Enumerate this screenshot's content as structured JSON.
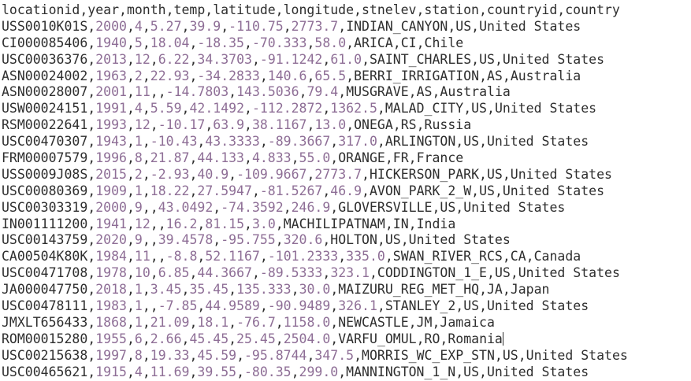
{
  "header": "locationid,year,month,temp,latitude,longitude,stnelev,station,countryid,country",
  "colors": {
    "text": "#2e2e2e",
    "number": "#8e6e96",
    "background": "#ffffff"
  },
  "rows": [
    [
      "USS0010K01S",
      "2000",
      "4",
      "5.27",
      "39.9",
      "-110.75",
      "2773.7",
      "INDIAN_CANYON",
      "US",
      "United States"
    ],
    [
      "CI000085406",
      "1940",
      "5",
      "18.04",
      "-18.35",
      "-70.333",
      "58.0",
      "ARICA",
      "CI",
      "Chile"
    ],
    [
      "USC00036376",
      "2013",
      "12",
      "6.22",
      "34.3703",
      "-91.1242",
      "61.0",
      "SAINT_CHARLES",
      "US",
      "United States"
    ],
    [
      "ASN00024002",
      "1963",
      "2",
      "22.93",
      "-34.2833",
      "140.6",
      "65.5",
      "BERRI_IRRIGATION",
      "AS",
      "Australia"
    ],
    [
      "ASN00028007",
      "2001",
      "11",
      "",
      "-14.7803",
      "143.5036",
      "79.4",
      "MUSGRAVE",
      "AS",
      "Australia"
    ],
    [
      "USW00024151",
      "1991",
      "4",
      "5.59",
      "42.1492",
      "-112.2872",
      "1362.5",
      "MALAD_CITY",
      "US",
      "United States"
    ],
    [
      "RSM00022641",
      "1993",
      "12",
      "-10.17",
      "63.9",
      "38.1167",
      "13.0",
      "ONEGA",
      "RS",
      "Russia"
    ],
    [
      "USC00470307",
      "1943",
      "1",
      "-10.43",
      "43.3333",
      "-89.3667",
      "317.0",
      "ARLINGTON",
      "US",
      "United States"
    ],
    [
      "FRM00007579",
      "1996",
      "8",
      "21.87",
      "44.133",
      "4.833",
      "55.0",
      "ORANGE",
      "FR",
      "France"
    ],
    [
      "USS0009J08S",
      "2015",
      "2",
      "-2.93",
      "40.9",
      "-109.9667",
      "2773.7",
      "HICKERSON_PARK",
      "US",
      "United States"
    ],
    [
      "USC00080369",
      "1909",
      "1",
      "18.22",
      "27.5947",
      "-81.5267",
      "46.9",
      "AVON_PARK_2_W",
      "US",
      "United States"
    ],
    [
      "USC00303319",
      "2000",
      "9",
      "",
      "43.0492",
      "-74.3592",
      "246.9",
      "GLOVERSVILLE",
      "US",
      "United States"
    ],
    [
      "IN001111200",
      "1941",
      "12",
      "",
      "16.2",
      "81.15",
      "3.0",
      "MACHILIPATNAM",
      "IN",
      "India"
    ],
    [
      "USC00143759",
      "2020",
      "9",
      "",
      "39.4578",
      "-95.755",
      "320.6",
      "HOLTON",
      "US",
      "United States"
    ],
    [
      "CA00504K80K",
      "1984",
      "11",
      "",
      "-8.8",
      "52.1167",
      "-101.2333",
      "335.0",
      "SWAN_RIVER_RCS",
      "CA",
      "Canada"
    ],
    [
      "USC00471708",
      "1978",
      "10",
      "6.85",
      "44.3667",
      "-89.5333",
      "323.1",
      "CODDINGTON_1_E",
      "US",
      "United States"
    ],
    [
      "JA000047750",
      "2018",
      "1",
      "3.45",
      "35.45",
      "135.333",
      "30.0",
      "MAIZURU_REG_MET_HQ",
      "JA",
      "Japan"
    ],
    [
      "USC00478111",
      "1983",
      "1",
      "",
      "-7.85",
      "44.9589",
      "-90.9489",
      "326.1",
      "STANLEY_2",
      "US",
      "United States"
    ],
    [
      "JMXLT656433",
      "1868",
      "1",
      "21.09",
      "18.1",
      "-76.7",
      "1158.0",
      "NEWCASTLE",
      "JM",
      "Jamaica"
    ],
    [
      "ROM00015280",
      "1955",
      "6",
      "2.66",
      "45.45",
      "25.45",
      "2504.0",
      "VARFU_OMUL",
      "RO",
      "Romania"
    ],
    [
      "USC00215638",
      "1997",
      "8",
      "19.33",
      "45.59",
      "-95.8744",
      "347.5",
      "MORRIS_WC_EXP_STN",
      "US",
      "United States"
    ],
    [
      "USC00465621",
      "1915",
      "4",
      "11.69",
      "39.55",
      "-80.35",
      "299.0",
      "MANNINGTON_1_N",
      "US",
      "United States"
    ]
  ],
  "cursor_row": 19
}
